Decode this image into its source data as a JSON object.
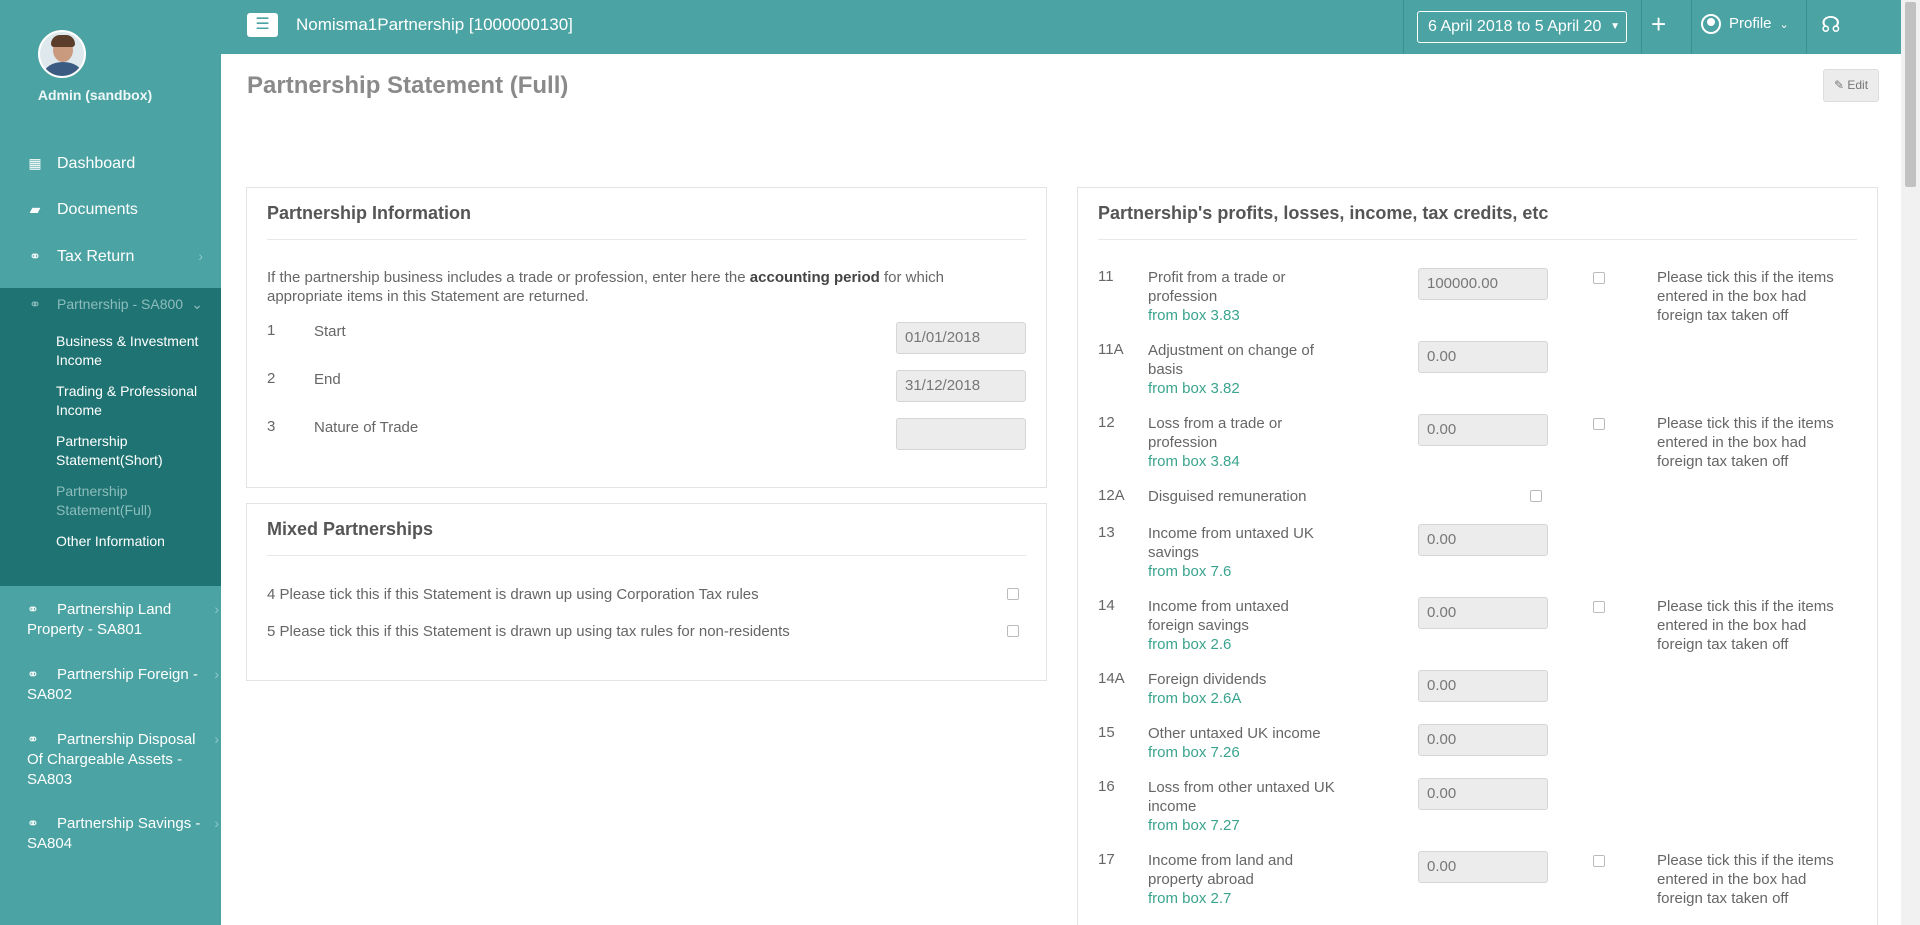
{
  "user": {
    "name": "Admin (sandbox)"
  },
  "sidebar": {
    "items": [
      {
        "label": "Dashboard"
      },
      {
        "label": "Documents"
      },
      {
        "label": "Tax Return"
      },
      {
        "label": "Partnership - SA800"
      }
    ],
    "sub_items": [
      "Business & Investment Income",
      "Trading & Professional Income",
      "Partnership Statement(Short)",
      "Partnership Statement(Full)",
      "Other Information"
    ],
    "extra_items": [
      "Partnership Land Property - SA801",
      "Partnership Foreign - SA802",
      "Partnership Disposal Of Chargeable Assets - SA803",
      "Partnership Savings - SA804"
    ]
  },
  "topbar": {
    "title": "Nomisma1Partnership [1000000130]",
    "period": "6 April 2018 to 5 April 20",
    "plus": "+",
    "profile": "Profile"
  },
  "page": {
    "title": "Partnership Statement (Full)",
    "edit_label": "Edit"
  },
  "info_panel": {
    "title": "Partnership Information",
    "intro_pre": "If the partnership business includes a trade or profession, enter here the ",
    "intro_bold": "accounting period",
    "intro_post": " for which appropriate items in this Statement are returned.",
    "rows": [
      {
        "num": "1",
        "label": "Start",
        "value": "01/01/2018"
      },
      {
        "num": "2",
        "label": "End",
        "value": "31/12/2018"
      },
      {
        "num": "3",
        "label": "Nature of Trade",
        "value": ""
      }
    ]
  },
  "mixed_panel": {
    "title": "Mixed Partnerships",
    "rows": [
      "4 Please tick this if this Statement is drawn up using Corporation Tax rules",
      "5 Please tick this if this Statement is drawn up using tax rules for non-residents"
    ]
  },
  "profits_panel": {
    "title": "Partnership's profits, losses, income, tax credits, etc",
    "foreign_note": "Please tick this if the items entered in the box had foreign tax taken off",
    "rows": [
      {
        "num": "11",
        "label": "Profit from a trade or profession",
        "from": "from box 3.83",
        "value": "100000.00"
      },
      {
        "num": "11A",
        "label": "Adjustment on change of basis",
        "from": "from box 3.82",
        "value": "0.00"
      },
      {
        "num": "12",
        "label": "Loss from a trade or profession",
        "from": "from box 3.84",
        "value": "0.00"
      },
      {
        "num": "12A",
        "label": "Disguised remuneration",
        "from": "",
        "value": ""
      },
      {
        "num": "13",
        "label": "Income from untaxed UK savings",
        "from": "from box 7.6",
        "value": "0.00"
      },
      {
        "num": "14",
        "label": "Income from untaxed foreign savings",
        "from": "from box 2.6",
        "value": "0.00"
      },
      {
        "num": "14A",
        "label": "Foreign dividends",
        "from": "from box 2.6A",
        "value": "0.00"
      },
      {
        "num": "15",
        "label": "Other untaxed UK income",
        "from": "from box 7.26",
        "value": "0.00"
      },
      {
        "num": "16",
        "label": "Loss from other untaxed UK income",
        "from": "from box 7.27",
        "value": "0.00"
      },
      {
        "num": "17",
        "label": "Income from land and property abroad",
        "from": "from box 2.7",
        "value": "0.00"
      }
    ]
  },
  "colors": {
    "brand": "#4ba3a3",
    "sidebar_active": "#1f7373",
    "link_green": "#3aa48e"
  }
}
